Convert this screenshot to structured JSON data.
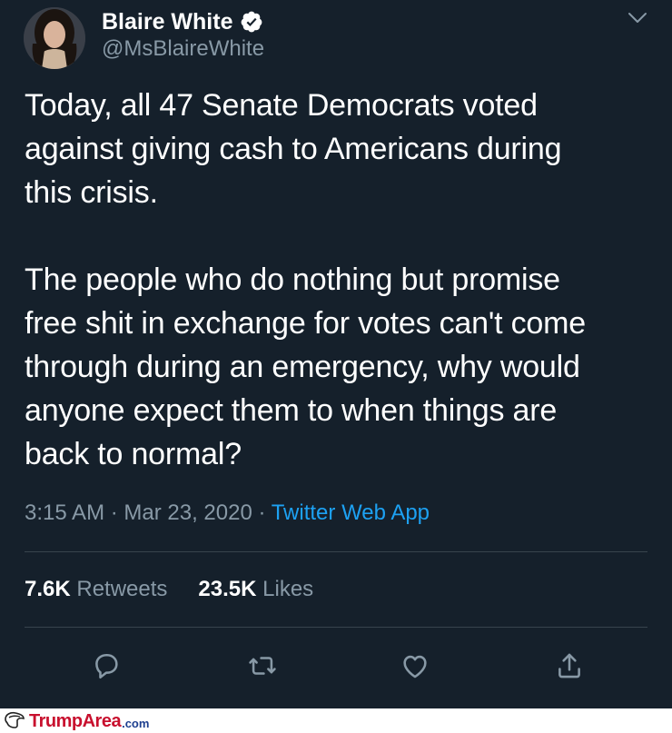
{
  "tweet": {
    "display_name": "Blaire White",
    "handle": "@MsBlaireWhite",
    "text": "Today, all 47 Senate Democrats voted\nagainst giving cash to Americans during\nthis crisis.\n\nThe people who do nothing but promise\nfree shit in exchange for votes can't come\nthrough during an emergency, why would\nanyone expect them to when things are\nback to normal?",
    "time": "3:15 AM",
    "separator": " · ",
    "date": "Mar 23, 2020",
    "source": "Twitter Web App",
    "retweets_count": "7.6K",
    "retweets_label": "Retweets",
    "likes_count": "23.5K",
    "likes_label": "Likes",
    "verified": true
  },
  "icons": {
    "verified": "verified-badge-icon",
    "caret": "chevron-down-icon",
    "reply": "reply-icon",
    "retweet": "retweet-icon",
    "like": "heart-icon",
    "share": "share-icon"
  },
  "footer": {
    "brand": "TrumpArea",
    "tld": ".com"
  },
  "colors": {
    "background": "#15202b",
    "text": "#ffffff",
    "secondary_text": "#8899a6",
    "link": "#1da1f2",
    "divider": "#38444d",
    "footer_brand": "#c8102e",
    "footer_tld": "#1d3f8f"
  }
}
